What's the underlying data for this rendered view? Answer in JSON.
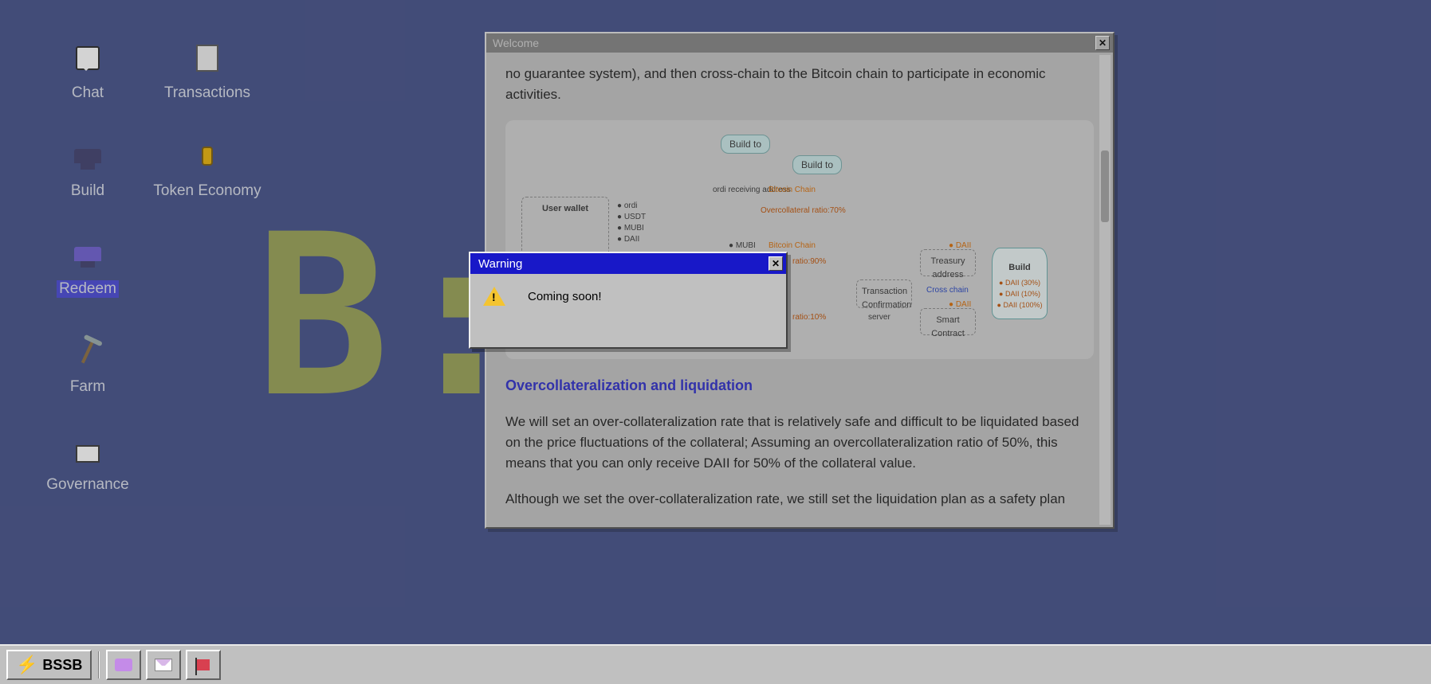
{
  "desktop": {
    "icons": [
      {
        "label": "Chat"
      },
      {
        "label": "Transactions"
      },
      {
        "label": "Build"
      },
      {
        "label": "Token Economy"
      },
      {
        "label": "Redeem"
      },
      {
        "label": "Farm"
      },
      {
        "label": "Governance"
      }
    ],
    "selected": "Redeem"
  },
  "welcome_window": {
    "title": "Welcome",
    "intro_fragment": "no guarantee system), and then cross-chain to the Bitcoin chain to participate in economic activities.",
    "diagram": {
      "build_to_1": "Build to",
      "build_to_2": "Build to",
      "ordi_addr": "ordi receiving address",
      "bitcoin_chain": "Bitcoin Chain",
      "overcollateral_70": "Overcollateral ratio:70%",
      "user_wallet": "User wallet",
      "tokens": [
        "ordi",
        "USDT",
        "MUBI",
        "DAII"
      ],
      "mubi": "MUBI",
      "ratio_90": "ratio:90%",
      "ratio_10": "ratio:10%",
      "tx_confirm": "Transaction Confirmation",
      "server": "server",
      "cross_chain": "Cross chain",
      "treasury": "Treasury address",
      "treasury_token": "DAII",
      "smart_contract": "Smart Contract",
      "build_label": "Build",
      "build_rows": [
        "DAII (30%)",
        "DAII (10%)",
        "DAII (100%)"
      ]
    },
    "section_heading": "Overcollateralization and liquidation",
    "para2": "We will set an over-collateralization rate that is relatively safe and difficult to be liquidated based on the price fluctuations of the collateral; Assuming an overcollateralization ratio of 50%, this means that you can only receive DAII for 50% of the collateral value.",
    "para3": "Although we set the over-collateralization rate, we still set the liquidation plan as a safety plan"
  },
  "warning_modal": {
    "title": "Warning",
    "message": "Coming soon!"
  },
  "taskbar": {
    "start_label": "BSSB"
  }
}
